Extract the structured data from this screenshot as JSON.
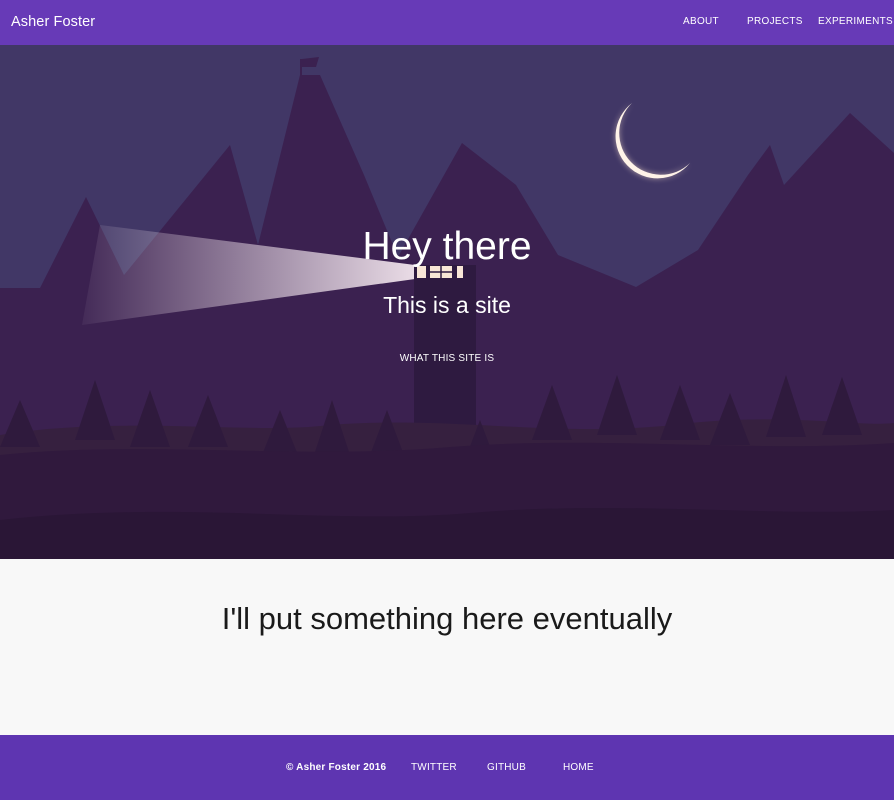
{
  "header": {
    "brand": "Asher Foster",
    "nav": [
      {
        "label": "ABOUT"
      },
      {
        "label": "PROJECTS"
      },
      {
        "label": "EXPERIMENTS"
      }
    ]
  },
  "hero": {
    "title": "Hey there",
    "subtitle": "This is a site",
    "cta_label": "WHAT THIS SITE IS"
  },
  "content": {
    "text": "I'll put something here eventually"
  },
  "footer": {
    "copyright": "© Asher Foster 2016",
    "links": [
      {
        "label": "TWITTER"
      },
      {
        "label": "GITHUB"
      },
      {
        "label": "HOME"
      }
    ]
  },
  "colors": {
    "header_bg": "#673ab7",
    "footer_bg": "#5e35b1",
    "sky": "#413766",
    "mountain": "#3b2150",
    "moon": "#fff3e8"
  },
  "icons": [
    "moon-icon",
    "flag-icon"
  ]
}
